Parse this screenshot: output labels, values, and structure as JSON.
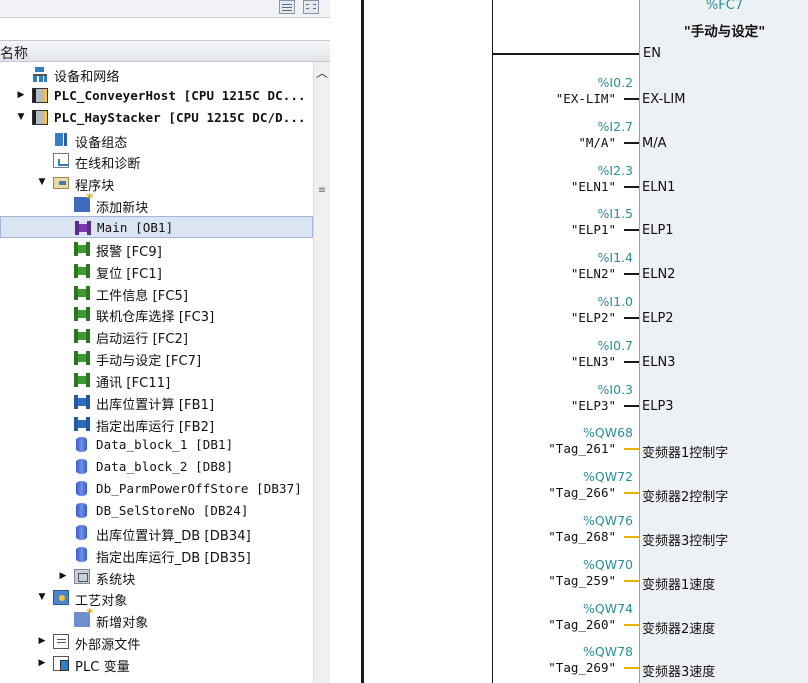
{
  "toolbar": {
    "buttons": [
      "list-view-icon",
      "grid-view-icon"
    ]
  },
  "tree": {
    "column_header": "名称",
    "rows": [
      {
        "label": "设备和网络",
        "indent": 1,
        "icon": "network-icon",
        "toggle": "",
        "style": ""
      },
      {
        "label": "PLC_ConveyerHost [CPU 1215C DC...",
        "indent": 1,
        "icon": "plc-icon",
        "toggle": "▶",
        "style": "b"
      },
      {
        "label": "PLC_HayStacker [CPU 1215C DC/D...",
        "indent": 1,
        "icon": "plc-icon",
        "toggle": "▼",
        "style": "b"
      },
      {
        "label": "设备组态",
        "indent": 2,
        "icon": "device-config-icon",
        "toggle": "",
        "style": ""
      },
      {
        "label": "在线和诊断",
        "indent": 2,
        "icon": "online-diagnostics-icon",
        "toggle": "",
        "style": ""
      },
      {
        "label": "程序块",
        "indent": 2,
        "icon": "program-folder-icon",
        "toggle": "▼",
        "style": ""
      },
      {
        "label": "添加新块",
        "indent": 3,
        "icon": "add-block-icon",
        "toggle": "",
        "style": ""
      },
      {
        "label": "Main [OB1]",
        "indent": 3,
        "icon": "ob-block-icon",
        "toggle": "",
        "style": "m",
        "selected": true
      },
      {
        "label": "报警 [FC9]",
        "indent": 3,
        "icon": "fc-block-icon",
        "toggle": "",
        "style": ""
      },
      {
        "label": "复位 [FC1]",
        "indent": 3,
        "icon": "fc-block-icon",
        "toggle": "",
        "style": ""
      },
      {
        "label": "工件信息 [FC5]",
        "indent": 3,
        "icon": "fc-block-icon",
        "toggle": "",
        "style": ""
      },
      {
        "label": "联机仓库选择 [FC3]",
        "indent": 3,
        "icon": "fc-block-icon",
        "toggle": "",
        "style": ""
      },
      {
        "label": "启动运行 [FC2]",
        "indent": 3,
        "icon": "fc-block-icon",
        "toggle": "",
        "style": ""
      },
      {
        "label": "手动与设定 [FC7]",
        "indent": 3,
        "icon": "fc-block-icon",
        "toggle": "",
        "style": ""
      },
      {
        "label": "通讯 [FC11]",
        "indent": 3,
        "icon": "fc-block-icon",
        "toggle": "",
        "style": ""
      },
      {
        "label": "出库位置计算 [FB1]",
        "indent": 3,
        "icon": "fb-block-icon",
        "toggle": "",
        "style": ""
      },
      {
        "label": "指定出库运行 [FB2]",
        "indent": 3,
        "icon": "fb-block-icon",
        "toggle": "",
        "style": ""
      },
      {
        "label": "Data_block_1 [DB1]",
        "indent": 3,
        "icon": "db-block-icon",
        "toggle": "",
        "style": "m"
      },
      {
        "label": "Data_block_2 [DB8]",
        "indent": 3,
        "icon": "db-block-icon",
        "toggle": "",
        "style": "m"
      },
      {
        "label": "Db_ParmPowerOffStore [DB37]",
        "indent": 3,
        "icon": "db-block-icon",
        "toggle": "",
        "style": "m"
      },
      {
        "label": "DB_SelStoreNo [DB24]",
        "indent": 3,
        "icon": "db-block-icon",
        "toggle": "",
        "style": "m"
      },
      {
        "label": "出库位置计算_DB [DB34]",
        "indent": 3,
        "icon": "db-block-icon",
        "toggle": "",
        "style": ""
      },
      {
        "label": "指定出库运行_DB [DB35]",
        "indent": 3,
        "icon": "db-block-icon",
        "toggle": "",
        "style": ""
      },
      {
        "label": "系统块",
        "indent": 3,
        "icon": "system-blocks-icon",
        "toggle": "▶",
        "style": ""
      },
      {
        "label": "工艺对象",
        "indent": 2,
        "icon": "technology-objects-icon",
        "toggle": "▼",
        "style": ""
      },
      {
        "label": "新增对象",
        "indent": 3,
        "icon": "add-object-icon",
        "toggle": "",
        "style": ""
      },
      {
        "label": "外部源文件",
        "indent": 2,
        "icon": "external-source-icon",
        "toggle": "▶",
        "style": ""
      },
      {
        "label": "PLC 变量",
        "indent": 2,
        "icon": "plc-tags-icon",
        "toggle": "▶",
        "style": ""
      }
    ]
  },
  "block": {
    "instance_address": "%FC7",
    "name": "\"手动与设定\"",
    "en_pin": "EN",
    "inputs": [
      {
        "address": "%I0.2",
        "tag": "\"EX-LIM\"",
        "pin": "EX-LIM",
        "wire": "black"
      },
      {
        "address": "%I2.7",
        "tag": "\"M/A\"",
        "pin": "M/A",
        "wire": "black"
      },
      {
        "address": "%I2.3",
        "tag": "\"ELN1\"",
        "pin": "ELN1",
        "wire": "black"
      },
      {
        "address": "%I1.5",
        "tag": "\"ELP1\"",
        "pin": "ELP1",
        "wire": "black"
      },
      {
        "address": "%I1.4",
        "tag": "\"ELN2\"",
        "pin": "ELN2",
        "wire": "black"
      },
      {
        "address": "%I1.0",
        "tag": "\"ELP2\"",
        "pin": "ELP2",
        "wire": "black"
      },
      {
        "address": "%I0.7",
        "tag": "\"ELN3\"",
        "pin": "ELN3",
        "wire": "black"
      },
      {
        "address": "%I0.3",
        "tag": "\"ELP3\"",
        "pin": "ELP3",
        "wire": "black"
      },
      {
        "address": "%QW68",
        "tag": "\"Tag_261\"",
        "pin": "变频器1控制字",
        "wire": "yellow"
      },
      {
        "address": "%QW72",
        "tag": "\"Tag_266\"",
        "pin": "变频器2控制字",
        "wire": "yellow"
      },
      {
        "address": "%QW76",
        "tag": "\"Tag_268\"",
        "pin": "变频器3控制字",
        "wire": "yellow"
      },
      {
        "address": "%QW70",
        "tag": "\"Tag_259\"",
        "pin": "变频器1速度",
        "wire": "yellow"
      },
      {
        "address": "%QW74",
        "tag": "\"Tag_260\"",
        "pin": "变频器2速度",
        "wire": "yellow"
      },
      {
        "address": "%QW78",
        "tag": "\"Tag_269\"",
        "pin": "变频器3速度",
        "wire": "yellow"
      }
    ]
  }
}
